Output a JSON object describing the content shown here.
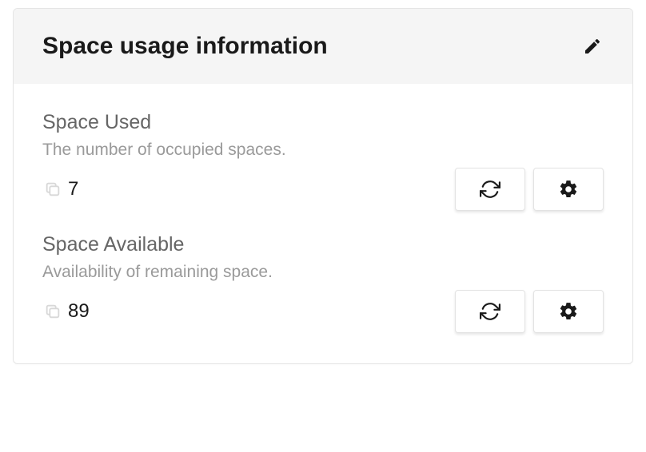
{
  "card": {
    "title": "Space usage information"
  },
  "metrics": [
    {
      "label": "Space Used",
      "description": "The number of occupied spaces.",
      "value": "7"
    },
    {
      "label": "Space Available",
      "description": "Availability of remaining space.",
      "value": "89"
    }
  ]
}
